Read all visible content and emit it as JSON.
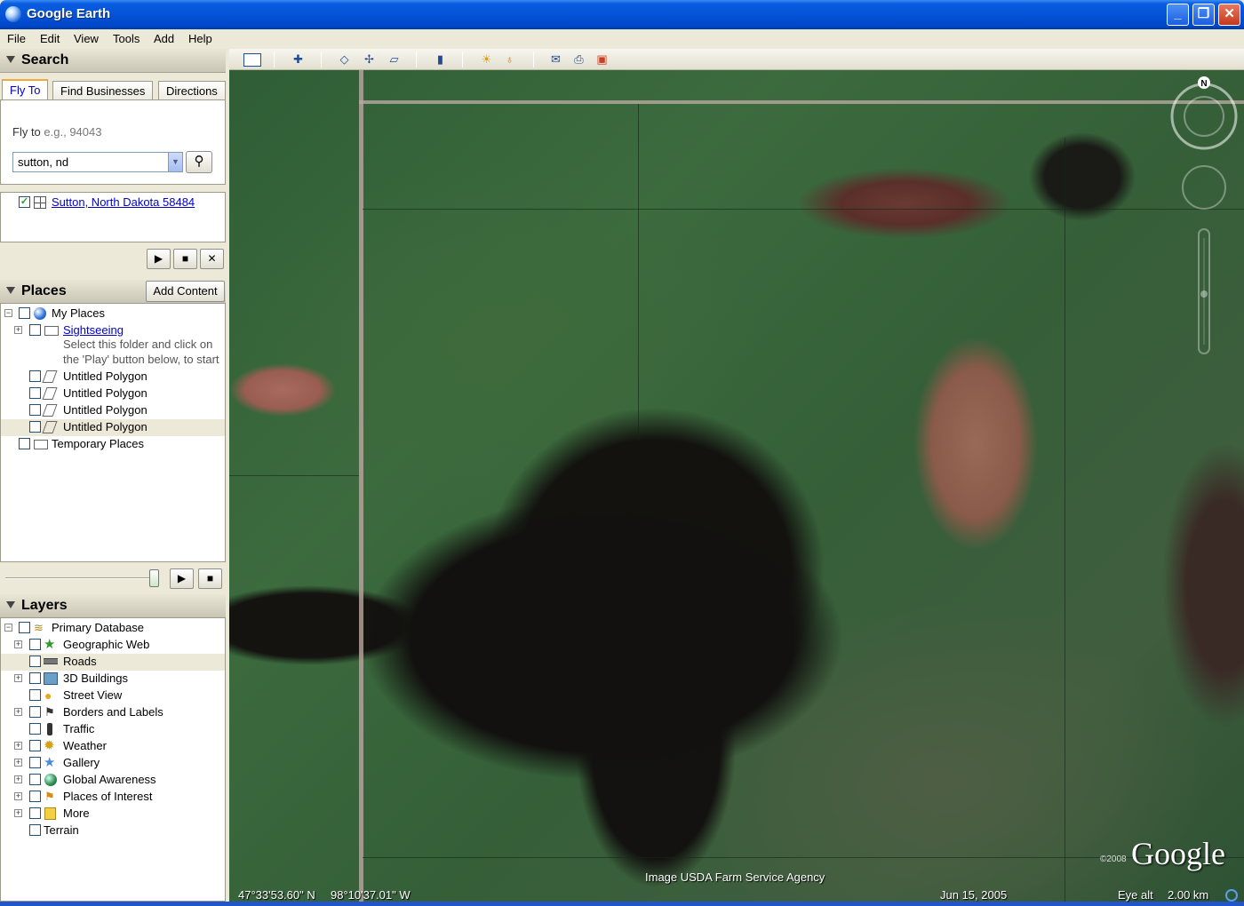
{
  "window": {
    "title": "Google Earth"
  },
  "menu": {
    "file": "File",
    "edit": "Edit",
    "view": "View",
    "tools": "Tools",
    "add": "Add",
    "help": "Help"
  },
  "search": {
    "header": "Search",
    "tabs": [
      "Fly To",
      "Find Businesses",
      "Directions"
    ],
    "fly_to_label": "Fly to",
    "fly_to_hint": "e.g., 94043",
    "input_value": "sutton, nd",
    "result": "Sutton, North Dakota 58484"
  },
  "places": {
    "header": "Places",
    "add_content": "Add Content",
    "items": [
      {
        "label": "My Places"
      },
      {
        "label": "Sightseeing"
      },
      {
        "label": "Untitled Polygon"
      },
      {
        "label": "Untitled Polygon"
      },
      {
        "label": "Untitled Polygon"
      },
      {
        "label": "Untitled Polygon"
      },
      {
        "label": "Temporary Places"
      }
    ],
    "note_line1": "Select this folder and click on",
    "note_line2": "the 'Play' button below, to start",
    "tour_slider_level": 1.0
  },
  "layers": {
    "header": "Layers",
    "items": [
      {
        "label": "Primary Database",
        "icon": "database-icon"
      },
      {
        "label": "Geographic Web",
        "icon": "star-icon"
      },
      {
        "label": "Roads",
        "icon": "road-icon"
      },
      {
        "label": "3D Buildings",
        "icon": "building-icon"
      },
      {
        "label": "Street View",
        "icon": "person-icon"
      },
      {
        "label": "Borders and Labels",
        "icon": "flag-icon"
      },
      {
        "label": "Traffic",
        "icon": "traffic-light-icon"
      },
      {
        "label": "Weather",
        "icon": "sun-icon"
      },
      {
        "label": "Gallery",
        "icon": "star-icon"
      },
      {
        "label": "Global Awareness",
        "icon": "globe-icon"
      },
      {
        "label": "Places of Interest",
        "icon": "pin-icon"
      },
      {
        "label": "More",
        "icon": "note-icon"
      },
      {
        "label": "Terrain",
        "icon": ""
      }
    ]
  },
  "map": {
    "latitude": "47°33'53.60\" N",
    "longitude": "98°10'37.01\" W",
    "attribution": "Image USDA Farm Service Agency",
    "date": "Jun 15, 2005",
    "eye_alt_label": "Eye alt",
    "eye_alt_value": "2.00 km",
    "logo": "Google",
    "copyright": "©2008",
    "compass_north": "N"
  }
}
